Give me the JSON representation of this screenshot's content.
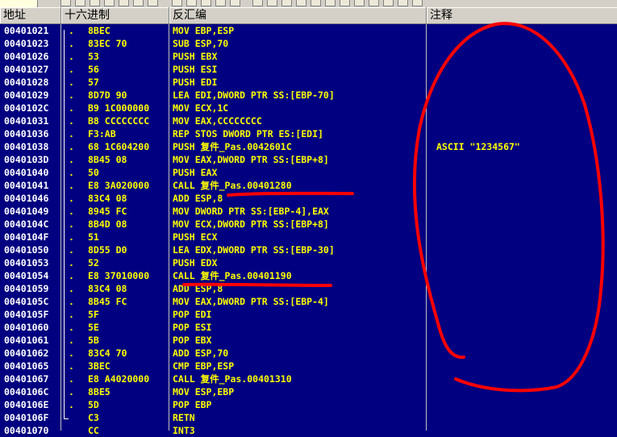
{
  "toolbar": {
    "field_text": ""
  },
  "columns": {
    "address": "地址",
    "hex": "十六进制",
    "disasm": "反汇编",
    "comment": "注释"
  },
  "rows": [
    {
      "addr": "00401021",
      "mark": ".",
      "hex": "8BEC",
      "dis": "MOV EBP,ESP",
      "comment": ""
    },
    {
      "addr": "00401023",
      "mark": ".",
      "hex": "83EC 70",
      "dis": "SUB ESP,70",
      "comment": ""
    },
    {
      "addr": "00401026",
      "mark": ".",
      "hex": "53",
      "dis": "PUSH EBX",
      "comment": ""
    },
    {
      "addr": "00401027",
      "mark": ".",
      "hex": "56",
      "dis": "PUSH ESI",
      "comment": ""
    },
    {
      "addr": "00401028",
      "mark": ".",
      "hex": "57",
      "dis": "PUSH EDI",
      "comment": ""
    },
    {
      "addr": "00401029",
      "mark": ".",
      "hex": "8D7D 90",
      "dis": "LEA EDI,DWORD PTR SS:[EBP-70]",
      "comment": ""
    },
    {
      "addr": "0040102C",
      "mark": ".",
      "hex": "B9 1C000000",
      "dis": "MOV ECX,1C",
      "comment": ""
    },
    {
      "addr": "00401031",
      "mark": ".",
      "hex": "B8 CCCCCCCC",
      "dis": "MOV EAX,CCCCCCCC",
      "comment": ""
    },
    {
      "addr": "00401036",
      "mark": ".",
      "hex": "F3:AB",
      "dis": "REP STOS DWORD PTR ES:[EDI]",
      "comment": ""
    },
    {
      "addr": "00401038",
      "mark": ".",
      "hex": "68 1C604200",
      "dis": "PUSH 复件_Pas.0042601C",
      "comment": "ASCII \"1234567\""
    },
    {
      "addr": "0040103D",
      "mark": ".",
      "hex": "8B45 08",
      "dis": "MOV EAX,DWORD PTR SS:[EBP+8]",
      "comment": ""
    },
    {
      "addr": "00401040",
      "mark": ".",
      "hex": "50",
      "dis": "PUSH EAX",
      "comment": ""
    },
    {
      "addr": "00401041",
      "mark": ".",
      "hex": "E8 3A020000",
      "dis": "CALL 复件_Pas.00401280",
      "comment": ""
    },
    {
      "addr": "00401046",
      "mark": ".",
      "hex": "83C4 08",
      "dis": "ADD ESP,8",
      "comment": ""
    },
    {
      "addr": "00401049",
      "mark": ".",
      "hex": "8945 FC",
      "dis": "MOV DWORD PTR SS:[EBP-4],EAX",
      "comment": ""
    },
    {
      "addr": "0040104C",
      "mark": ".",
      "hex": "8B4D 08",
      "dis": "MOV ECX,DWORD PTR SS:[EBP+8]",
      "comment": ""
    },
    {
      "addr": "0040104F",
      "mark": ".",
      "hex": "51",
      "dis": "PUSH ECX",
      "comment": ""
    },
    {
      "addr": "00401050",
      "mark": ".",
      "hex": "8D55 D0",
      "dis": "LEA EDX,DWORD PTR SS:[EBP-30]",
      "comment": ""
    },
    {
      "addr": "00401053",
      "mark": ".",
      "hex": "52",
      "dis": "PUSH EDX",
      "comment": ""
    },
    {
      "addr": "00401054",
      "mark": ".",
      "hex": "E8 37010000",
      "dis": "CALL 复件_Pas.00401190",
      "comment": ""
    },
    {
      "addr": "00401059",
      "mark": ".",
      "hex": "83C4 08",
      "dis": "ADD ESP,8",
      "comment": ""
    },
    {
      "addr": "0040105C",
      "mark": ".",
      "hex": "8B45 FC",
      "dis": "MOV EAX,DWORD PTR SS:[EBP-4]",
      "comment": ""
    },
    {
      "addr": "0040105F",
      "mark": ".",
      "hex": "5F",
      "dis": "POP EDI",
      "comment": ""
    },
    {
      "addr": "00401060",
      "mark": ".",
      "hex": "5E",
      "dis": "POP ESI",
      "comment": ""
    },
    {
      "addr": "00401061",
      "mark": ".",
      "hex": "5B",
      "dis": "POP EBX",
      "comment": ""
    },
    {
      "addr": "00401062",
      "mark": ".",
      "hex": "83C4 70",
      "dis": "ADD ESP,70",
      "comment": ""
    },
    {
      "addr": "00401065",
      "mark": ".",
      "hex": "3BEC",
      "dis": "CMP EBP,ESP",
      "comment": ""
    },
    {
      "addr": "00401067",
      "mark": ".",
      "hex": "E8 A4020000",
      "dis": "CALL 复件_Pas.00401310",
      "comment": ""
    },
    {
      "addr": "0040106C",
      "mark": ".",
      "hex": "8BE5",
      "dis": "MOV ESP,EBP",
      "comment": ""
    },
    {
      "addr": "0040106E",
      "mark": ".",
      "hex": "5D",
      "dis": "POP EBP",
      "comment": ""
    },
    {
      "addr": "0040106F",
      "mark": "",
      "hex": "C3",
      "dis": "RETN",
      "comment": ""
    },
    {
      "addr": "00401070",
      "mark": "",
      "hex": "CC",
      "dis": "INT3",
      "comment": ""
    }
  ],
  "colors": {
    "background": "#000080",
    "address_text": "#ffffff",
    "code_text": "#ffff00",
    "annotation": "#ff0000",
    "header_bg": "#d4d0c8"
  },
  "annotations": {
    "underline_rows": [
      12,
      19
    ],
    "highlighted_comment_row": 9
  }
}
